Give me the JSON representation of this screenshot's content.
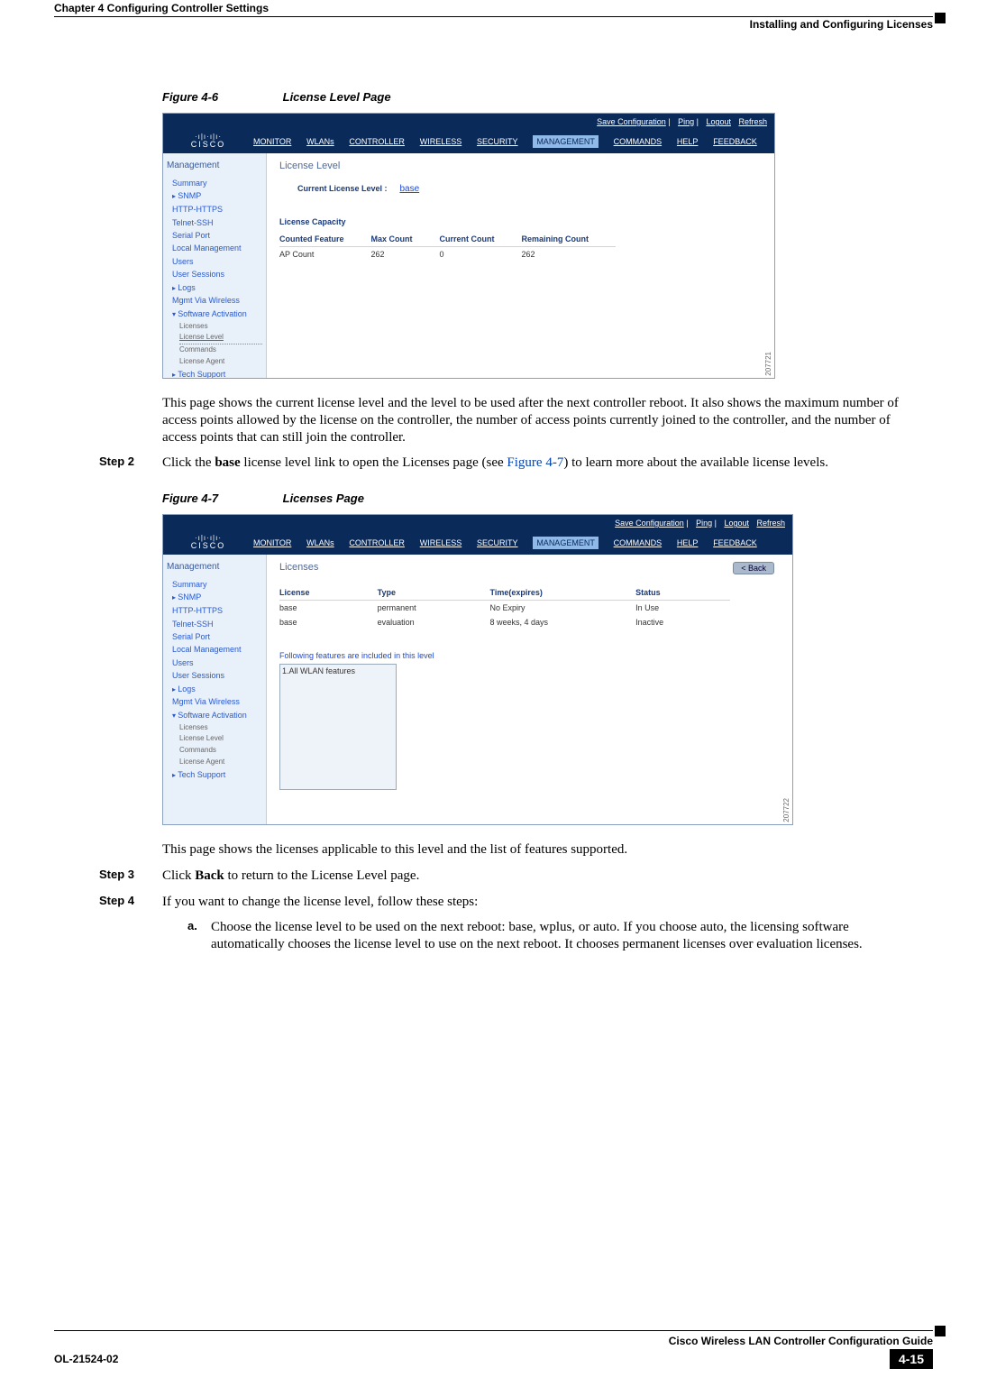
{
  "header": {
    "chapter_left": "Chapter 4      Configuring Controller Settings",
    "right": "Installing and Configuring Licenses"
  },
  "fig6": {
    "label_num": "Figure 4-6",
    "label_title": "License Level Page",
    "topbar": {
      "save": "Save Configuration",
      "ping": "Ping",
      "logout": "Logout",
      "refresh": "Refresh"
    },
    "logo_line1": "·ı|ı·ı|ı·",
    "logo_line2": "CISCO",
    "nav": [
      "MONITOR",
      "WLANs",
      "CONTROLLER",
      "WIRELESS",
      "SECURITY",
      "MANAGEMENT",
      "COMMANDS",
      "HELP",
      "FEEDBACK"
    ],
    "side_title": "Management",
    "side_items": [
      "Summary",
      "SNMP",
      "HTTP-HTTPS",
      "Telnet-SSH",
      "Serial Port",
      "Local Management Users",
      "User Sessions",
      "Logs",
      "Mgmt Via Wireless",
      "Software Activation"
    ],
    "side_sub": [
      "Licenses",
      "License Level",
      "Commands",
      "License Agent"
    ],
    "side_last": "Tech Support",
    "main_title": "License Level",
    "curr_label": "Current License Level :",
    "curr_value": "base",
    "cap_title": "License Capacity",
    "cap_headers": [
      "Counted Feature",
      "Max Count",
      "Current Count",
      "Remaining Count"
    ],
    "cap_row": [
      "AP Count",
      "262",
      "0",
      "262"
    ],
    "sidecode": "207721"
  },
  "para1": "This page shows the current license level and the level to be used after the next controller reboot. It also shows the maximum number of access points allowed by the license on the controller, the number of access points currently joined to the controller, and the number of access points that can still join the controller.",
  "step2": {
    "label": "Step 2",
    "pre": "Click the ",
    "bold": "base",
    "mid": " license level link to open the Licenses page (see ",
    "xref": "Figure 4-7",
    "post": ") to learn more about the available license levels."
  },
  "fig7": {
    "label_num": "Figure 4-7",
    "label_title": "Licenses Page",
    "main_title": "Licenses",
    "back": "< Back",
    "headers": [
      "License",
      "Type",
      "Time(expires)",
      "Status"
    ],
    "row1": [
      "base",
      "permanent",
      "No Expiry",
      "In Use"
    ],
    "row2": [
      "base",
      "evaluation",
      "8 weeks, 4 days",
      "Inactive"
    ],
    "feat_label": "Following features are included in this level",
    "feat_item": "1.All WLAN features",
    "sidecode": "207722"
  },
  "para2": "This page shows the licenses applicable to this level and the list of features supported.",
  "step3": {
    "label": "Step 3",
    "pre": "Click ",
    "bold": "Back",
    "post": " to return to the License Level page."
  },
  "step4": {
    "label": "Step 4",
    "text": "If you want to change the license level, follow these steps:"
  },
  "sub_a": {
    "label": "a.",
    "pre": "Choose the license level to be used on the next reboot: ",
    "b1": "base",
    "c1": ", ",
    "b2": "wplus",
    "c2": ", or ",
    "b3": "auto",
    "mid": ". If you choose ",
    "b4": "auto",
    "post": ", the licensing software automatically chooses the license level to use on the next reboot. It chooses permanent licenses over evaluation licenses."
  },
  "footer": {
    "title": "Cisco Wireless LAN Controller Configuration Guide",
    "ol": "OL-21524-02",
    "page": "4-15"
  }
}
